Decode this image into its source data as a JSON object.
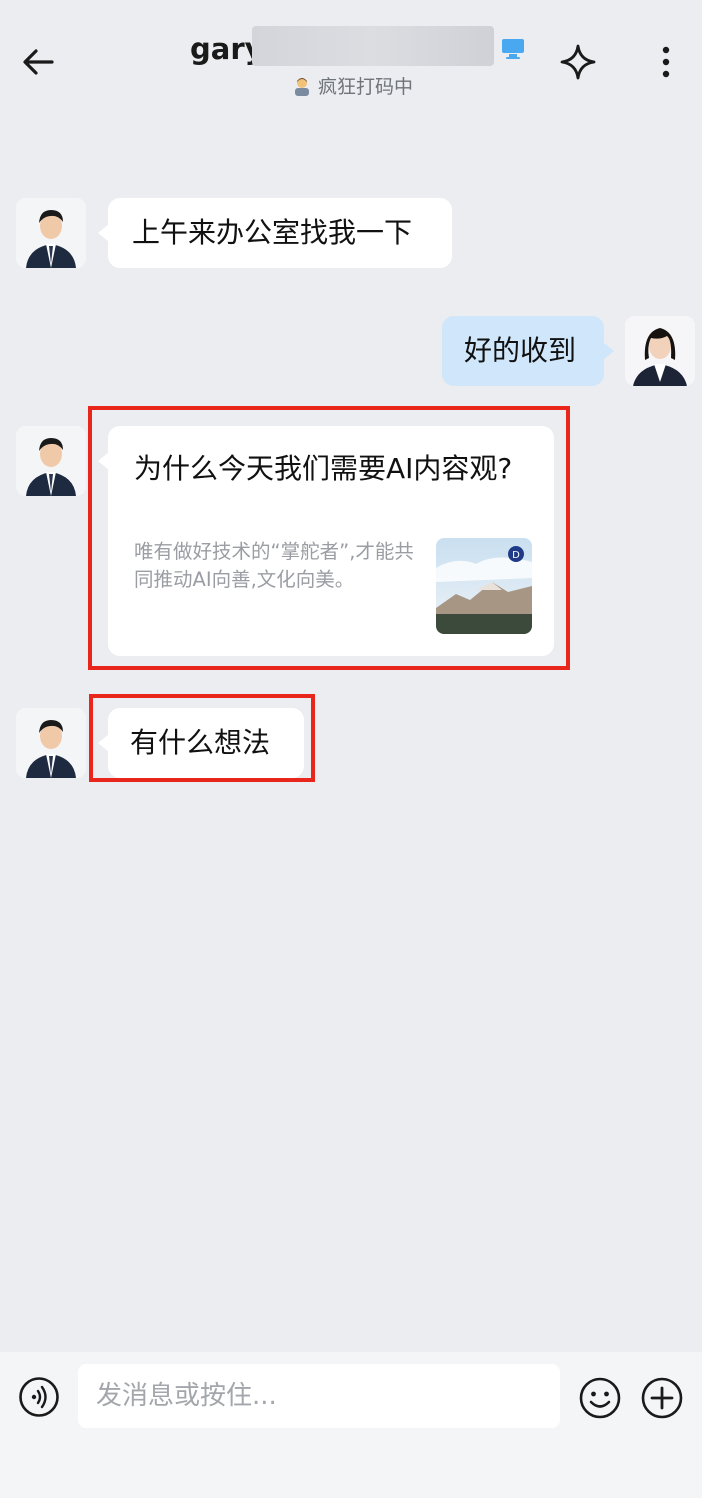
{
  "header": {
    "back_icon": "arrow-left-icon",
    "title_visible": "gary",
    "device_icon": "computer-icon",
    "status_text": "疯狂打码中",
    "status_icon": "person-emoji-icon",
    "sparkle_icon": "sparkle-icon",
    "more_icon": "more-vertical-icon"
  },
  "messages": [
    {
      "sender": "other",
      "type": "text",
      "text": "上午来办公室找我一下"
    },
    {
      "sender": "me",
      "type": "text",
      "text": "好的收到"
    },
    {
      "sender": "other",
      "type": "card",
      "title": "为什么今天我们需要AI内容观?",
      "desc": "唯有做好技术的“掌舵者”,才能共同推动AI向善,文化向美。",
      "thumb": "landscape-image"
    },
    {
      "sender": "other",
      "type": "text",
      "text": "有什么想法"
    }
  ],
  "input": {
    "placeholder": "发消息或按住...",
    "voice_icon": "voice-icon",
    "emoji_icon": "emoji-icon",
    "plus_icon": "plus-icon"
  },
  "colors": {
    "background": "#ecedf1",
    "my_bubble": "#cfe6fb",
    "highlight": "#e8261c"
  }
}
